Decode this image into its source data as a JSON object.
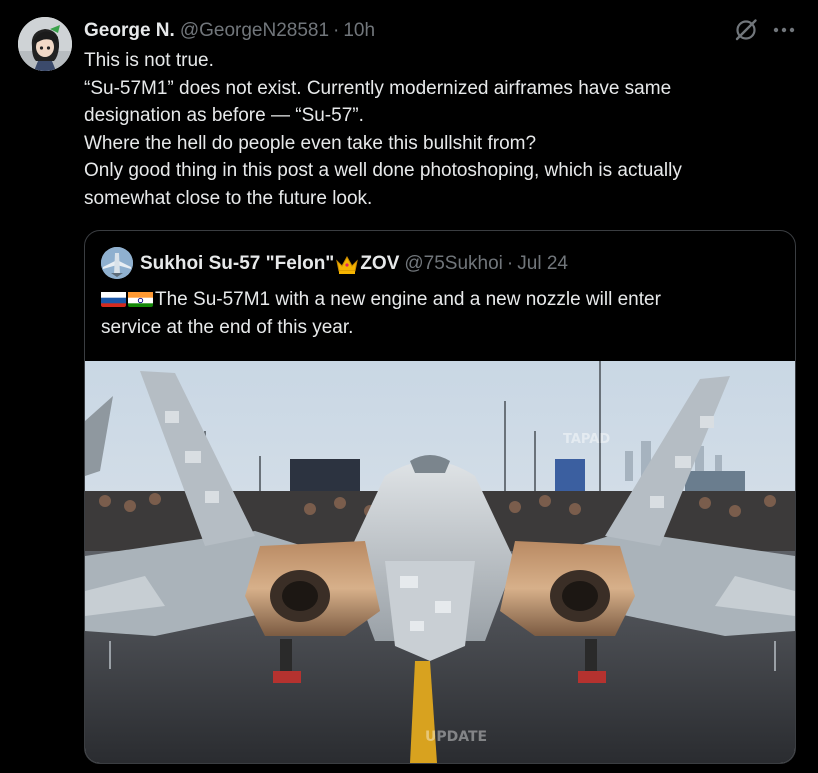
{
  "tweet": {
    "author_name": "George N.",
    "author_handle": "@GeorgeN28581",
    "separator": "·",
    "time": "10h",
    "text_lines": [
      "This is not true.",
      "“Su-57M1” does not exist. Currently modernized airframes have same",
      "designation as before — “Su-57”.",
      "Where the hell do people even take this bullshit from?",
      "Only good thing in this post a well done photoshoping, which is actually",
      "somewhat close to the future look."
    ]
  },
  "quoted": {
    "author_name_prefix": "Sukhoi Su-57 \"Felon\"",
    "author_name_suffix": "ZOV",
    "author_handle": "@75Sukhoi",
    "separator": "·",
    "date": "Jul 24",
    "text_line1": "The Su-57M1 with a new engine and a new nozzle will enter",
    "text_line2": "service at the end of this year.",
    "image_watermarks": {
      "top": "TAPAD",
      "bottom": "UPDATE"
    }
  },
  "icons": {
    "grok": "grok-icon",
    "more": "more-icon",
    "flag_1": "russia-flag-icon",
    "flag_2": "india-flag-icon",
    "crown": "crown-icon"
  },
  "colors": {
    "background": "#000000",
    "text_primary": "#e7e9ea",
    "text_secondary": "#71767b",
    "border": "#3a3d41"
  }
}
